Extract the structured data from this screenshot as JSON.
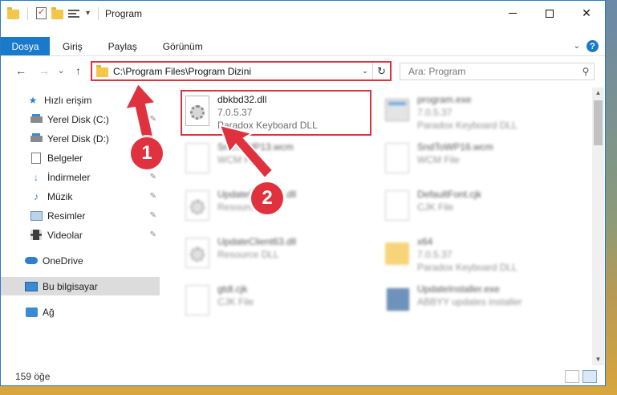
{
  "window": {
    "title": "Program",
    "controls": {
      "minimize": "—",
      "maximize": "☐",
      "close": "✕"
    }
  },
  "ribbon": {
    "file_tab": "Dosya",
    "tabs": [
      "Giriş",
      "Paylaş",
      "Görünüm"
    ],
    "expand_icon": "chevron-down-icon",
    "help": "?"
  },
  "address": {
    "path": "C:\\Program Files\\Program Dizini",
    "dropdown": "⌄",
    "refresh": "↻"
  },
  "nav_buttons": {
    "back": "←",
    "forward": "→",
    "recent": "⌄",
    "up": "↑"
  },
  "search": {
    "placeholder": "Ara: Program",
    "icon": "⚲"
  },
  "sidebar": {
    "items": [
      {
        "label": "Hızlı erişim",
        "icon": "star-icon"
      },
      {
        "label": "Yerel Disk (C:)",
        "icon": "disk-icon",
        "pinned": true
      },
      {
        "label": "Yerel Disk (D:)",
        "icon": "disk-icon"
      },
      {
        "label": "Belgeler",
        "icon": "document-icon"
      },
      {
        "label": "İndirmeler",
        "icon": "download-icon",
        "pinned": true
      },
      {
        "label": "Müzik",
        "icon": "music-icon",
        "pinned": true
      },
      {
        "label": "Resimler",
        "icon": "pictures-icon",
        "pinned": true
      },
      {
        "label": "Videolar",
        "icon": "videos-icon",
        "pinned": true
      },
      {
        "label": "OneDrive",
        "icon": "onedrive-icon"
      },
      {
        "label": "Bu bilgisayar",
        "icon": "computer-icon",
        "selected": true
      },
      {
        "label": "Ağ",
        "icon": "network-icon"
      }
    ],
    "pin_glyph": "✎"
  },
  "files": [
    {
      "name": "dbkbd32.dll",
      "line2": "7.0.5.37",
      "line3": "Paradox Keyboard DLL",
      "icon": "dll-gear-icon",
      "highlighted": true
    },
    {
      "name": "program.exe",
      "line2": "7.0.5.37",
      "line3": "Paradox Keyboard DLL",
      "icon": "exe-icon"
    },
    {
      "name": "SndToWP13.wcm",
      "line2": "WCM File",
      "line3": "",
      "icon": "file-icon"
    },
    {
      "name": "SndToWP16.wcm",
      "line2": "WCM File",
      "line3": "",
      "icon": "file-icon"
    },
    {
      "name": "UpdateClient65.dll",
      "line2": "Resource DLL",
      "line3": "",
      "icon": "dll-gear-icon"
    },
    {
      "name": "DefaultFont.cjk",
      "line2": "CJK File",
      "line3": "",
      "icon": "file-icon"
    },
    {
      "name": "UpdateClient63.dll",
      "line2": "Resource DLL",
      "line3": "",
      "icon": "dll-gear-icon"
    },
    {
      "name": "x64",
      "line2": "7.0.5.37",
      "line3": "Paradox Keyboard DLL",
      "icon": "folder-icon"
    },
    {
      "name": "gtdl.cjk",
      "line2": "CJK File",
      "line3": "",
      "icon": "file-icon"
    },
    {
      "name": "UpdateInstaller.exe",
      "line2": "ABBYY updates installer",
      "line3": "",
      "icon": "installer-icon"
    }
  ],
  "scrollbar": {
    "up": "▲",
    "down": "▼"
  },
  "status": {
    "count": "159 öğe"
  },
  "annotations": {
    "marker1": "1",
    "marker2": "2"
  },
  "colors": {
    "accent": "#1979ca",
    "highlight": "#e0323e",
    "selection": "#dcdcdc"
  }
}
